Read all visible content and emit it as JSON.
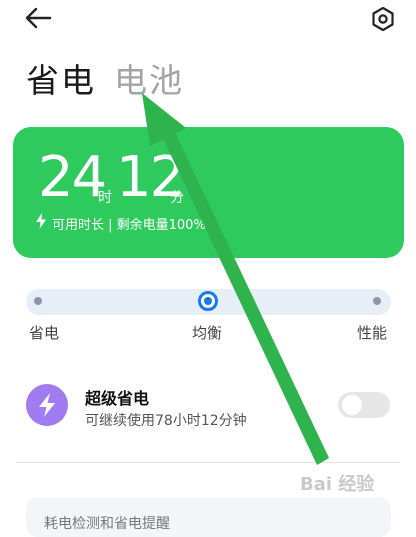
{
  "header": {
    "back_icon": "arrow-left-icon",
    "settings_icon": "gear-icon"
  },
  "tabs": [
    {
      "label": "省电",
      "active": true
    },
    {
      "label": "电池",
      "active": false
    }
  ],
  "battery_card": {
    "hours": "24",
    "hours_unit": "时",
    "minutes": "12",
    "minutes_unit": "分",
    "info_text": "可用时长 | 剩余电量100%",
    "color": "#2fca5d"
  },
  "mode_slider": {
    "labels": [
      "省电",
      "均衡",
      "性能"
    ],
    "selected": "均衡",
    "accent": "#1777ee"
  },
  "super_saver": {
    "title": "超级省电",
    "subtitle": "可继续使用78小时12分钟",
    "enabled": false,
    "icon": "lightning-icon",
    "icon_color": "#a17cf0"
  },
  "bottom_card": {
    "text": "耗电检测和省电提醒"
  },
  "watermark": {
    "text": "Bai 经验"
  },
  "annotation": {
    "arrow_color": "#2fb34c"
  }
}
